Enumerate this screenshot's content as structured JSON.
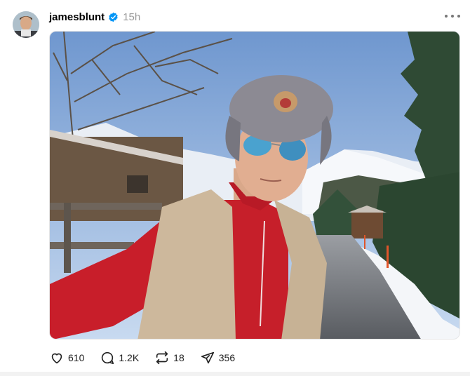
{
  "post": {
    "username": "jamesblunt",
    "time": "15h",
    "verified_color": "#0095f6",
    "icons": {
      "avatar": "profile-photo",
      "verified": "verified-badge-icon",
      "more": "more-horizontal-icon"
    }
  },
  "image": {
    "description_icon": "photo"
  },
  "actions": {
    "likes": "610",
    "replies": "1.2K",
    "reposts": "18",
    "shares": "356",
    "icons": [
      "heart-icon",
      "comment-icon",
      "repost-icon",
      "share-icon"
    ]
  }
}
